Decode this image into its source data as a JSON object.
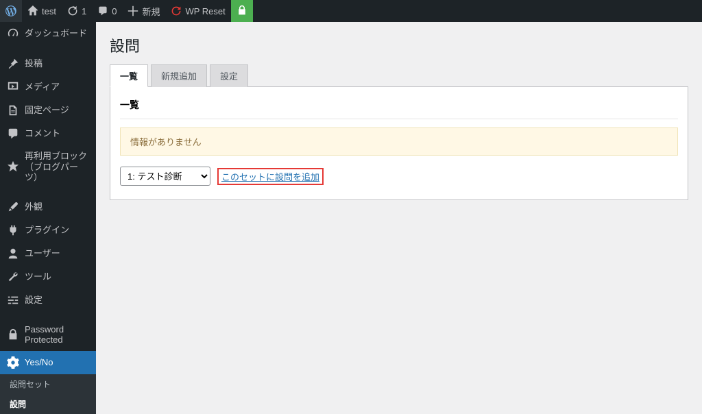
{
  "adminbar": {
    "site_name": "test",
    "updates_count": "1",
    "comments_count": "0",
    "new_label": "新規",
    "wp_reset_label": "WP Reset"
  },
  "sidebar": {
    "dashboard": "ダッシュボード",
    "posts": "投稿",
    "media": "メディア",
    "pages": "固定ページ",
    "comments": "コメント",
    "reusable": "再利用ブロック（ブログパーツ）",
    "appearance": "外観",
    "plugins": "プラグイン",
    "users": "ユーザー",
    "tools": "ツール",
    "settings": "設定",
    "password_protected": "Password Protected",
    "yesno": "Yes/No",
    "submenu": {
      "question_set": "設問セット",
      "question": "設問"
    }
  },
  "main": {
    "title": "設問",
    "tabs": {
      "list": "一覧",
      "add": "新規追加",
      "settings": "設定"
    },
    "panel_title": "一覧",
    "notice": "情報がありません",
    "select_option": "1: テスト診断",
    "add_link": "このセットに設問を追加"
  }
}
